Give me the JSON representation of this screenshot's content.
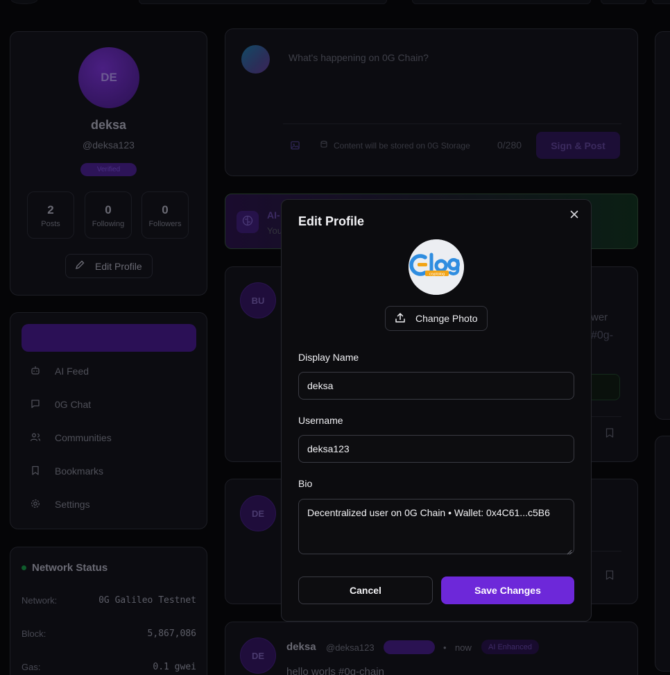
{
  "profile": {
    "avatar_initials": "DE",
    "name": "deksa",
    "handle": "@deksa123",
    "badge": "Verified",
    "stats": [
      {
        "value": "2",
        "label": "Posts"
      },
      {
        "value": "0",
        "label": "Following"
      },
      {
        "value": "0",
        "label": "Followers"
      }
    ],
    "edit_label": "Edit Profile"
  },
  "nav": {
    "items": [
      {
        "label": "AI Feed",
        "icon": "bot-icon"
      },
      {
        "label": "0G Chat",
        "icon": "chat-icon"
      },
      {
        "label": "Communities",
        "icon": "users-icon"
      },
      {
        "label": "Bookmarks",
        "icon": "bookmark-icon"
      },
      {
        "label": "Settings",
        "icon": "gear-icon"
      }
    ]
  },
  "network": {
    "title": "Network Status",
    "rows": [
      {
        "key": "Network:",
        "value": "0G Galileo Testnet"
      },
      {
        "key": "Block:",
        "value": "5,867,086"
      },
      {
        "key": "Gas:",
        "value": "0.1 gwei"
      }
    ]
  },
  "composer": {
    "placeholder": "What's happening on 0G Chain?",
    "storage_note": "Content will be stored on 0G Storage",
    "char_count": "0/280",
    "post_button": "Sign & Post"
  },
  "banner": {
    "title": "AI-",
    "subtitle": "You"
  },
  "feed": {
    "post1": {
      "initials": "BU",
      "text_a": "wer",
      "text_b": "#0g-"
    },
    "post2": {
      "initials": "DE"
    },
    "post3": {
      "initials": "DE",
      "name": "deksa",
      "handle": "@deksa123",
      "time": "now",
      "tag": "AI Enhanced",
      "text": "hello worls #0g-chain"
    }
  },
  "modal": {
    "title": "Edit Profile",
    "change_photo": "Change Photo",
    "display_name_label": "Display Name",
    "display_name_value": "deksa",
    "username_label": "Username",
    "username_value": "deksa123",
    "bio_label": "Bio",
    "bio_value": "Decentralized user on 0G Chain • Wallet: 0x4C61...c5B6",
    "cancel": "Cancel",
    "save": "Save Changes",
    "logo_text": "CLOG",
    "logo_sub": "cryptolog"
  },
  "colors": {
    "accent": "#6d28d9",
    "background": "#050507",
    "modal_bg": "#0c0c0f"
  }
}
